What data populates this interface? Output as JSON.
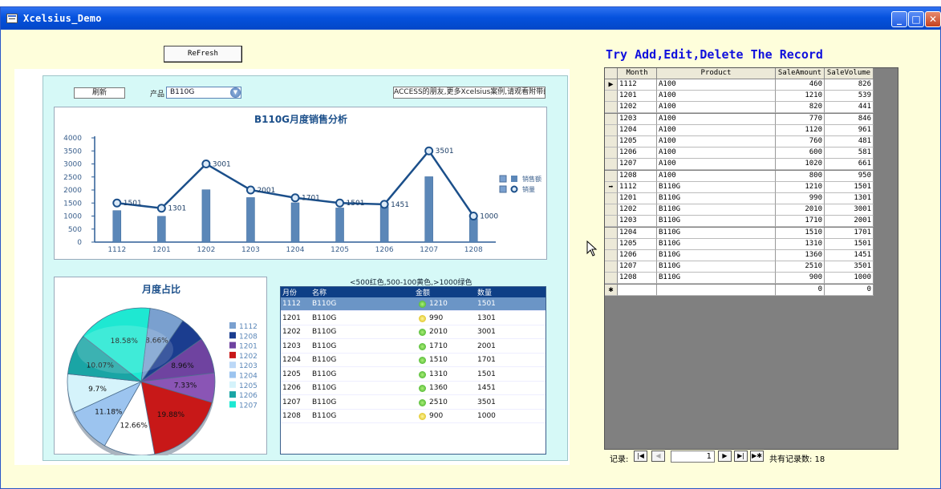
{
  "window": {
    "title": "Xcelsius_Demo",
    "min_glyph": "_",
    "max_glyph": "□",
    "close_glyph": "✕"
  },
  "form": {
    "refresh_label": "ReFresh",
    "title": "Try Add,Edit,Delete The Record"
  },
  "xcelsius": {
    "refresh_label": "刷新",
    "product_label": "产品",
    "product_value": "B110G",
    "ticker_text": "ACCESS的朋友,更多Xcelsius案例,请观看附带的",
    "grid_caption": "<500红色,500-100黄色,>1000绿色",
    "grid_headers": [
      "月份",
      "名称",
      "金额",
      "数量"
    ],
    "grid_rows": [
      {
        "month": "1112",
        "name": "B110G",
        "amount": "1210",
        "qty": "1501",
        "status": "green"
      },
      {
        "month": "1201",
        "name": "B110G",
        "amount": "990",
        "qty": "1301",
        "status": "yellow"
      },
      {
        "month": "1202",
        "name": "B110G",
        "amount": "2010",
        "qty": "3001",
        "status": "green"
      },
      {
        "month": "1203",
        "name": "B110G",
        "amount": "1710",
        "qty": "2001",
        "status": "green"
      },
      {
        "month": "1204",
        "name": "B110G",
        "amount": "1510",
        "qty": "1701",
        "status": "green"
      },
      {
        "month": "1205",
        "name": "B110G",
        "amount": "1310",
        "qty": "1501",
        "status": "green"
      },
      {
        "month": "1206",
        "name": "B110G",
        "amount": "1360",
        "qty": "1451",
        "status": "green"
      },
      {
        "month": "1207",
        "name": "B110G",
        "amount": "2510",
        "qty": "3501",
        "status": "green"
      },
      {
        "month": "1208",
        "name": "B110G",
        "amount": "900",
        "qty": "1000",
        "status": "yellow"
      }
    ]
  },
  "chart_data": [
    {
      "type": "bar",
      "title": "B110G月度销售分析",
      "categories": [
        "1112",
        "1201",
        "1202",
        "1203",
        "1204",
        "1205",
        "1206",
        "1207",
        "1208"
      ],
      "ylim": [
        0,
        4000
      ],
      "yticks": [
        "0",
        "500",
        "1000",
        "1500",
        "2000",
        "2500",
        "3000",
        "3500",
        "4000"
      ],
      "series": [
        {
          "name": "销售额",
          "kind": "bar",
          "color": "#5b87b8",
          "values": [
            1210,
            990,
            2010,
            1710,
            1510,
            1310,
            1360,
            2510,
            900
          ]
        },
        {
          "name": "销量",
          "kind": "line",
          "color": "#1b4f8a",
          "values": [
            1501,
            1301,
            3001,
            2001,
            1701,
            1501,
            1451,
            3501,
            1000
          ]
        }
      ],
      "data_labels": [
        "1501",
        "1301",
        "3001",
        "2001",
        "1701",
        "1501",
        "1451",
        "3501",
        "1000"
      ],
      "legend": "right",
      "grid": false
    },
    {
      "type": "pie",
      "title": "月度占比",
      "slices": [
        {
          "label": "1112",
          "pct_label": "8.66%",
          "value": 8.66,
          "color": "#7aa0cf"
        },
        {
          "label": "1208",
          "pct_label": "",
          "value": 6.44,
          "color": "#1b3d8f"
        },
        {
          "label": "1201",
          "pct_label": "8.96%",
          "value": 8.96,
          "color": "#6f43a0"
        },
        {
          "label": "1202",
          "pct_label": "7.33%",
          "value": 7.33,
          "color": "#8a55b5"
        },
        {
          "label": "1203",
          "pct_label": "19.88%",
          "value": 19.88,
          "color": "#c81818"
        },
        {
          "label": "1204",
          "pct_label": "12.66%",
          "value": 12.66,
          "color": "#ffffff"
        },
        {
          "label": "1205",
          "pct_label": "11.18%",
          "value": 11.18,
          "color": "#9cc4ef"
        },
        {
          "label": "1206",
          "pct_label": "9.7%",
          "value": 9.7,
          "color": "#d5f3fb"
        },
        {
          "label": "1207",
          "pct_label": "10.07%",
          "value": 10.07,
          "color": "#1aa5a5"
        },
        {
          "label": "",
          "pct_label": "18.58%",
          "value": 18.58,
          "color": "#1ee8d2"
        }
      ],
      "legend": [
        "1112",
        "1208",
        "1201",
        "1202",
        "1203",
        "1204",
        "1205",
        "1206",
        "1207"
      ],
      "legend_colors": [
        "#7aa0cf",
        "#1b3d8f",
        "#6f43a0",
        "#c81818",
        "#bcd8f7",
        "#9cc4ef",
        "#d5f3fb",
        "#1aa5a5",
        "#1ee8d2"
      ]
    }
  ],
  "datasheet": {
    "headers": [
      "Month",
      "Product",
      "SaleAmount",
      "SaleVolume"
    ],
    "rows": [
      {
        "sel": "▶",
        "month": "1112",
        "product": "A100",
        "amount": "460",
        "volume": "826"
      },
      {
        "sel": "",
        "month": "1201",
        "product": "A100",
        "amount": "1210",
        "volume": "539"
      },
      {
        "sel": "",
        "month": "1202",
        "product": "A100",
        "amount": "820",
        "volume": "441"
      },
      {
        "sel": "",
        "month": "1203",
        "product": "A100",
        "amount": "770",
        "volume": "846"
      },
      {
        "sel": "",
        "month": "1204",
        "product": "A100",
        "amount": "1120",
        "volume": "961"
      },
      {
        "sel": "",
        "month": "1205",
        "product": "A100",
        "amount": "760",
        "volume": "481"
      },
      {
        "sel": "",
        "month": "1206",
        "product": "A100",
        "amount": "600",
        "volume": "581"
      },
      {
        "sel": "",
        "month": "1207",
        "product": "A100",
        "amount": "1020",
        "volume": "661"
      },
      {
        "sel": "",
        "month": "1208",
        "product": "A100",
        "amount": "800",
        "volume": "950"
      },
      {
        "sel": "➡",
        "month": "1112",
        "product": "B110G",
        "amount": "1210",
        "volume": "1501"
      },
      {
        "sel": "",
        "month": "1201",
        "product": "B110G",
        "amount": "990",
        "volume": "1301"
      },
      {
        "sel": "",
        "month": "1202",
        "product": "B110G",
        "amount": "2010",
        "volume": "3001"
      },
      {
        "sel": "",
        "month": "1203",
        "product": "B110G",
        "amount": "1710",
        "volume": "2001"
      },
      {
        "sel": "",
        "month": "1204",
        "product": "B110G",
        "amount": "1510",
        "volume": "1701"
      },
      {
        "sel": "",
        "month": "1205",
        "product": "B110G",
        "amount": "1310",
        "volume": "1501"
      },
      {
        "sel": "",
        "month": "1206",
        "product": "B110G",
        "amount": "1360",
        "volume": "1451"
      },
      {
        "sel": "",
        "month": "1207",
        "product": "B110G",
        "amount": "2510",
        "volume": "3501"
      },
      {
        "sel": "",
        "month": "1208",
        "product": "B110G",
        "amount": "900",
        "volume": "1000"
      },
      {
        "sel": "✱",
        "month": "",
        "product": "",
        "amount": "0",
        "volume": "0"
      }
    ]
  },
  "nav": {
    "label": "记录:",
    "first": "|◀",
    "prev": "◀",
    "next": "▶",
    "last": "▶|",
    "new": "▶✱",
    "current": "1",
    "total_text": "共有记录数: 18"
  },
  "icons": [
    "app-icon",
    "dropdown-icon",
    "cursor-icon"
  ]
}
